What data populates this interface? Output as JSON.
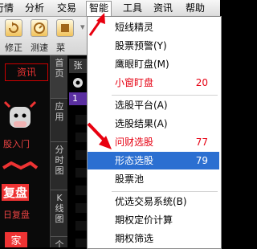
{
  "menubar": {
    "items": [
      {
        "label": "行情"
      },
      {
        "label": "分析"
      },
      {
        "label": "交易"
      },
      {
        "label": "智能"
      },
      {
        "label": "工具"
      },
      {
        "label": "资讯"
      },
      {
        "label": "帮助"
      }
    ]
  },
  "toolbar": {
    "labels": [
      "修正",
      "测速",
      "菜"
    ]
  },
  "leftpane": {
    "tab_label": "资讯",
    "items": [
      {
        "label": "股入门"
      },
      {
        "label": "复盘"
      },
      {
        "label": "日复盘"
      },
      {
        "label": "家"
      }
    ]
  },
  "sidetabs": {
    "items": [
      {
        "label": "首页"
      },
      {
        "label": "应用"
      },
      {
        "label": "分时图"
      },
      {
        "label": "K线图"
      },
      {
        "label": "个股"
      }
    ]
  },
  "rightstrip": {
    "top_glyph": "张",
    "row_number": "1"
  },
  "dropdown": {
    "items": [
      {
        "label": "短线精灵"
      },
      {
        "label": "股票预警(Y)"
      },
      {
        "label": "鹰眼盯盘(M)"
      },
      {
        "label": "小窗盯盘",
        "shortcut": "20"
      },
      {
        "label": "选股平台(A)"
      },
      {
        "label": "选股结果(A)"
      },
      {
        "label": "问财选股",
        "shortcut": "77"
      },
      {
        "label": "形态选股",
        "shortcut": "79"
      },
      {
        "label": "股票池"
      },
      {
        "label": "优选交易系统(B)"
      },
      {
        "label": "期权定价计算"
      },
      {
        "label": "期权筛选"
      }
    ]
  },
  "colors": {
    "highlight": "#2b6fd1",
    "accent_red": "#e60012",
    "arrow_red": "#e8000f"
  }
}
